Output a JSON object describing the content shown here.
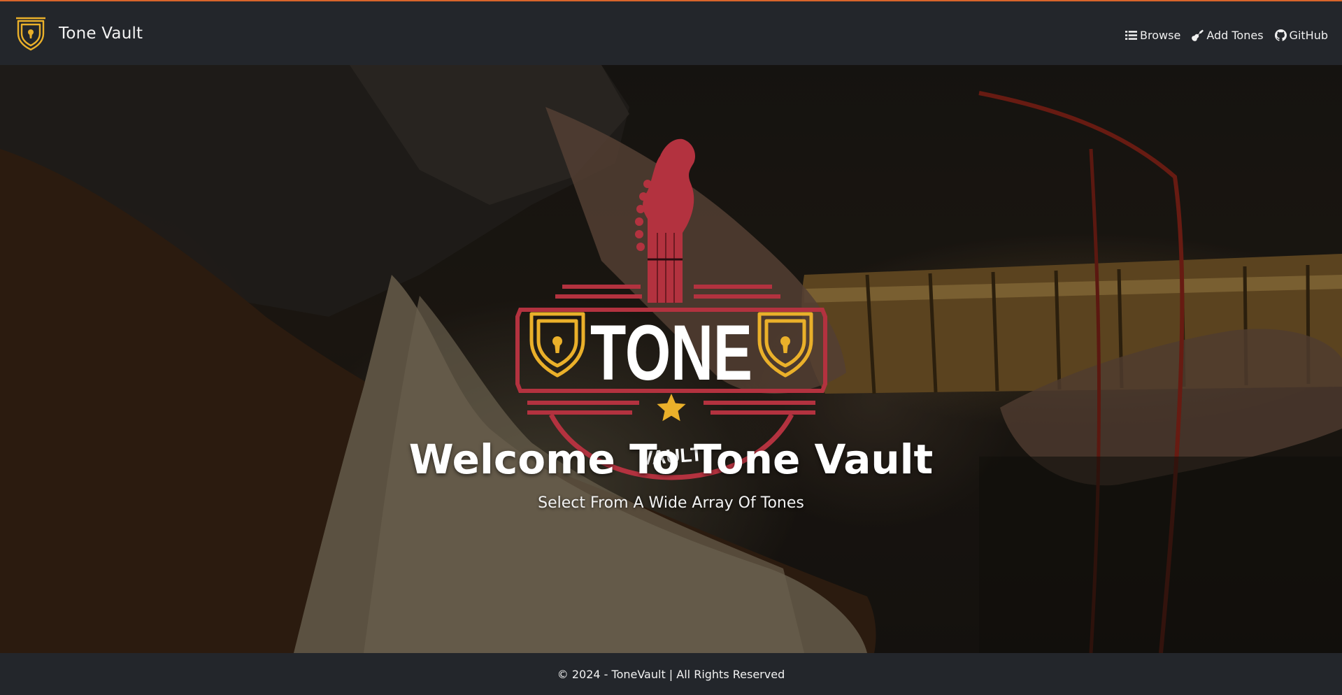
{
  "colors": {
    "accent": "#d9652b",
    "navbar_bg": "#23262b",
    "logo_red": "#b3323f",
    "logo_gold": "#eab02a"
  },
  "navbar": {
    "brand_name": "Tone Vault",
    "brand_icon": "shield-lock-icon",
    "links": [
      {
        "label": "Browse",
        "icon": "list-icon"
      },
      {
        "label": "Add Tones",
        "icon": "guitar-icon"
      },
      {
        "label": "GitHub",
        "icon": "github-icon"
      }
    ]
  },
  "hero": {
    "logo": {
      "top_word": "TONE",
      "bottom_word": "VAULT"
    },
    "title": "Welcome To Tone Vault",
    "subtitle": "Select From A Wide Array Of Tones"
  },
  "footer": {
    "text": "© 2024 - ToneVault | All Rights Reserved"
  }
}
